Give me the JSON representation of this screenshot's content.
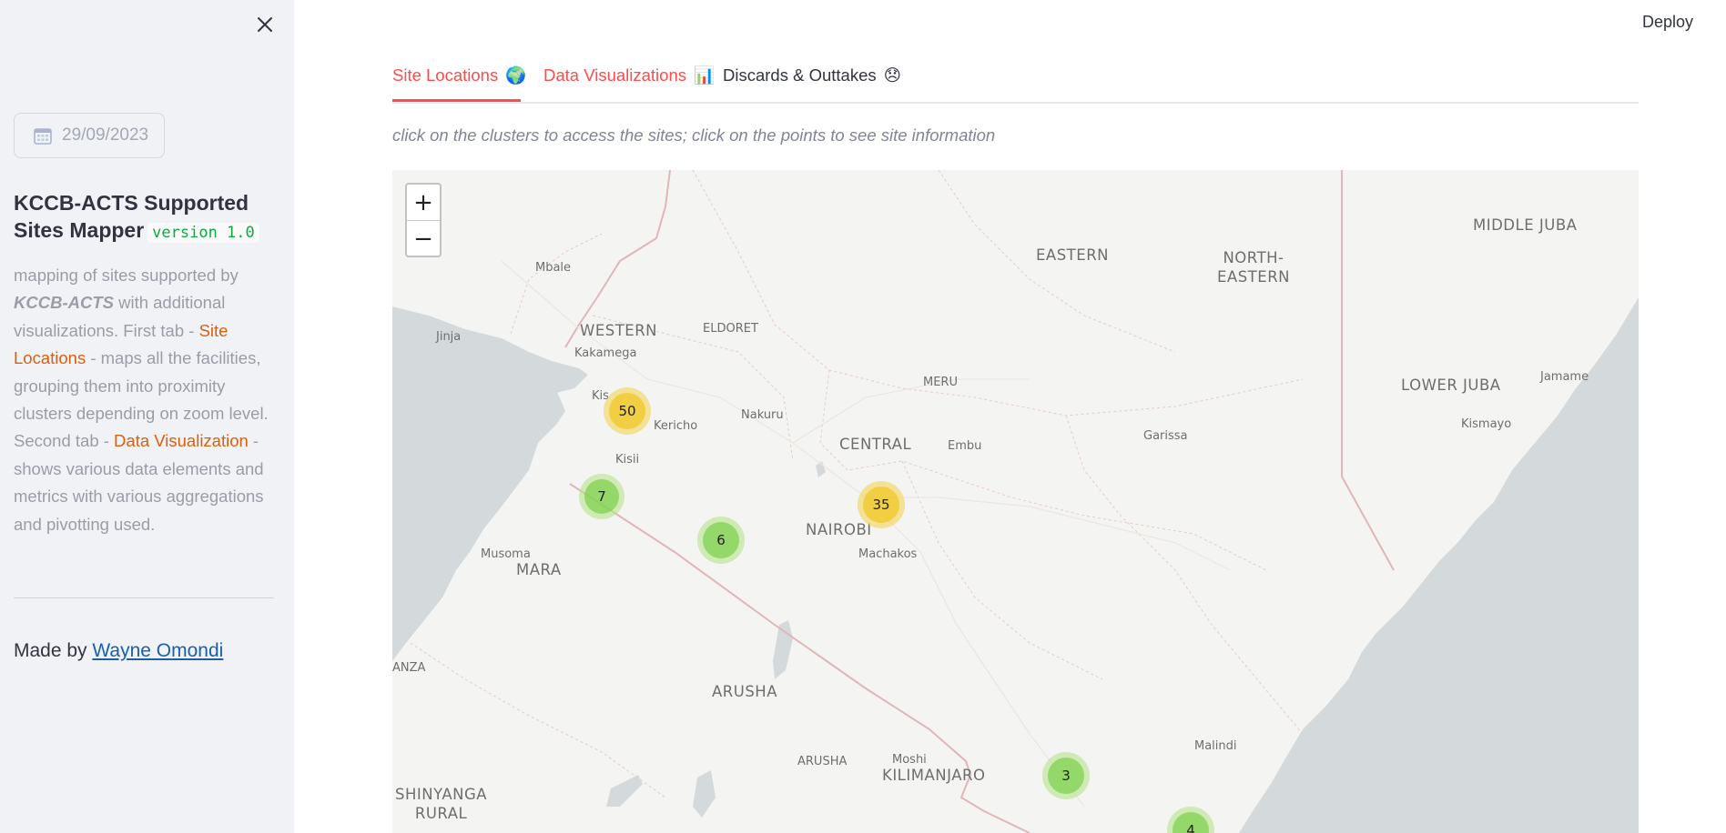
{
  "sidebar": {
    "close_icon": "close-icon",
    "date_value": "29/09/2023",
    "title": "KCCB-ACTS Supported Sites Mapper",
    "version": "version 1.0",
    "description": {
      "p1": "mapping of sites supported by ",
      "org": "KCCB-ACTS",
      "p2": " with additional visualizations. First tab - ",
      "tab1": "Site Locations",
      "p3": " - maps all the facilities, grouping them into proximity clusters depending on zoom level. Second tab - ",
      "tab2": "Data Visualization",
      "p4": " - shows various data elements and metrics with various aggregations and pivotting used."
    },
    "made_by_prefix": "Made by ",
    "made_by_name": "Wayne Omondi"
  },
  "header": {
    "deploy_label": "Deploy"
  },
  "tabs": [
    {
      "label": "Site Locations",
      "emoji": "🌍",
      "active": true
    },
    {
      "label": "Data Visualizations",
      "emoji": "📊",
      "active": false
    },
    {
      "label": "Discards & Outtakes",
      "emoji": "😞",
      "active": false
    }
  ],
  "caption": "click on the clusters to access the sites; click on the points to see site information",
  "map": {
    "zoom_in": "+",
    "zoom_out": "−",
    "water_color": "#d4dadc",
    "land_color": "#f4f4f2",
    "labels": {
      "mbale": "Mbale",
      "western": "WESTERN",
      "eldoret": "ELDORET",
      "kakamega": "Kakamega",
      "jinja": "Jinja",
      "kisumu": "Kis",
      "kericho": "Kericho",
      "kisii": "Kisii",
      "nakuru": "Nakuru",
      "meru": "MERU",
      "central": "CENTRAL",
      "embu": "Embu",
      "eastern": "EASTERN",
      "north_eastern": "NORTH-\nEASTERN",
      "middle_juba": "MIDDLE JUBA",
      "lower_juba": "LOWER JUBA",
      "jamame": "Jamame",
      "kismayo": "Kismayo",
      "garissa": "Garissa",
      "nairobi": "NAIROBI",
      "machakos": "Machakos",
      "musoma": "Musoma",
      "mara": "MARA",
      "anza": "ANZA",
      "arusha_region": "ARUSHA",
      "arusha": "ARUSHA",
      "moshi": "Moshi",
      "kilimanjaro": "KILIMANJARO",
      "malindi": "Malindi",
      "shinyanga": "SHINYANGA\nRURAL"
    },
    "clusters": [
      {
        "count": "50",
        "level": "medium"
      },
      {
        "count": "7",
        "level": "small"
      },
      {
        "count": "6",
        "level": "small"
      },
      {
        "count": "35",
        "level": "medium"
      },
      {
        "count": "3",
        "level": "small"
      },
      {
        "count": "4",
        "level": "small"
      }
    ]
  }
}
